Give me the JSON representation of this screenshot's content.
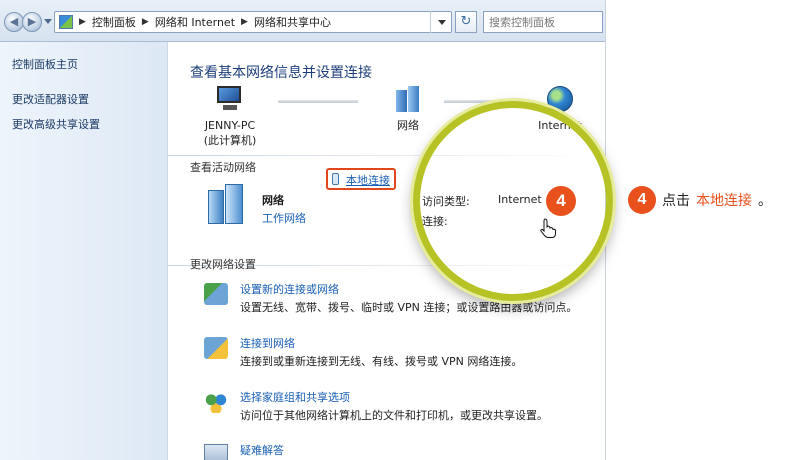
{
  "address_bar": {
    "crumbs": [
      "控制面板",
      "网络和 Internet",
      "网络和共享中心"
    ],
    "search_placeholder": "搜索控制面板"
  },
  "sidebar": {
    "items": [
      {
        "label": "控制面板主页"
      },
      {
        "label": "更改适配器设置"
      },
      {
        "label": "更改高级共享设置"
      }
    ]
  },
  "main": {
    "title": "查看基本网络信息并设置连接",
    "map": {
      "pc_name": "JENNY-PC",
      "pc_sub": "(此计算机)",
      "network": "网络",
      "internet": "Internet"
    },
    "active_section": "查看活动网络",
    "active_network": {
      "name": "网络",
      "type": "工作网络",
      "access_label": "访问类型:",
      "access_value": "Internet",
      "connection_label": "连接:",
      "connection_value": "本地连接"
    },
    "change_section": "更改网络设置",
    "settings": [
      {
        "title": "设置新的连接或网络",
        "desc": "设置无线、宽带、拨号、临时或 VPN 连接；或设置路由器或访问点。"
      },
      {
        "title": "连接到网络",
        "desc": "连接到或重新连接到无线、有线、拨号或 VPN 网络连接。"
      },
      {
        "title": "选择家庭组和共享选项",
        "desc": "访问位于其他网络计算机上的文件和打印机，或更改共享设置。"
      },
      {
        "title": "疑难解答",
        "desc": ""
      }
    ]
  },
  "callout": {
    "step": "4",
    "text_before": "点击",
    "text_highlight": "本地连接",
    "text_after": "。"
  },
  "colors": {
    "accent_orange": "#e8501c",
    "link_blue": "#1a5fb4",
    "title_blue": "#1e3e7b",
    "lens_ring": "#b7c224"
  }
}
